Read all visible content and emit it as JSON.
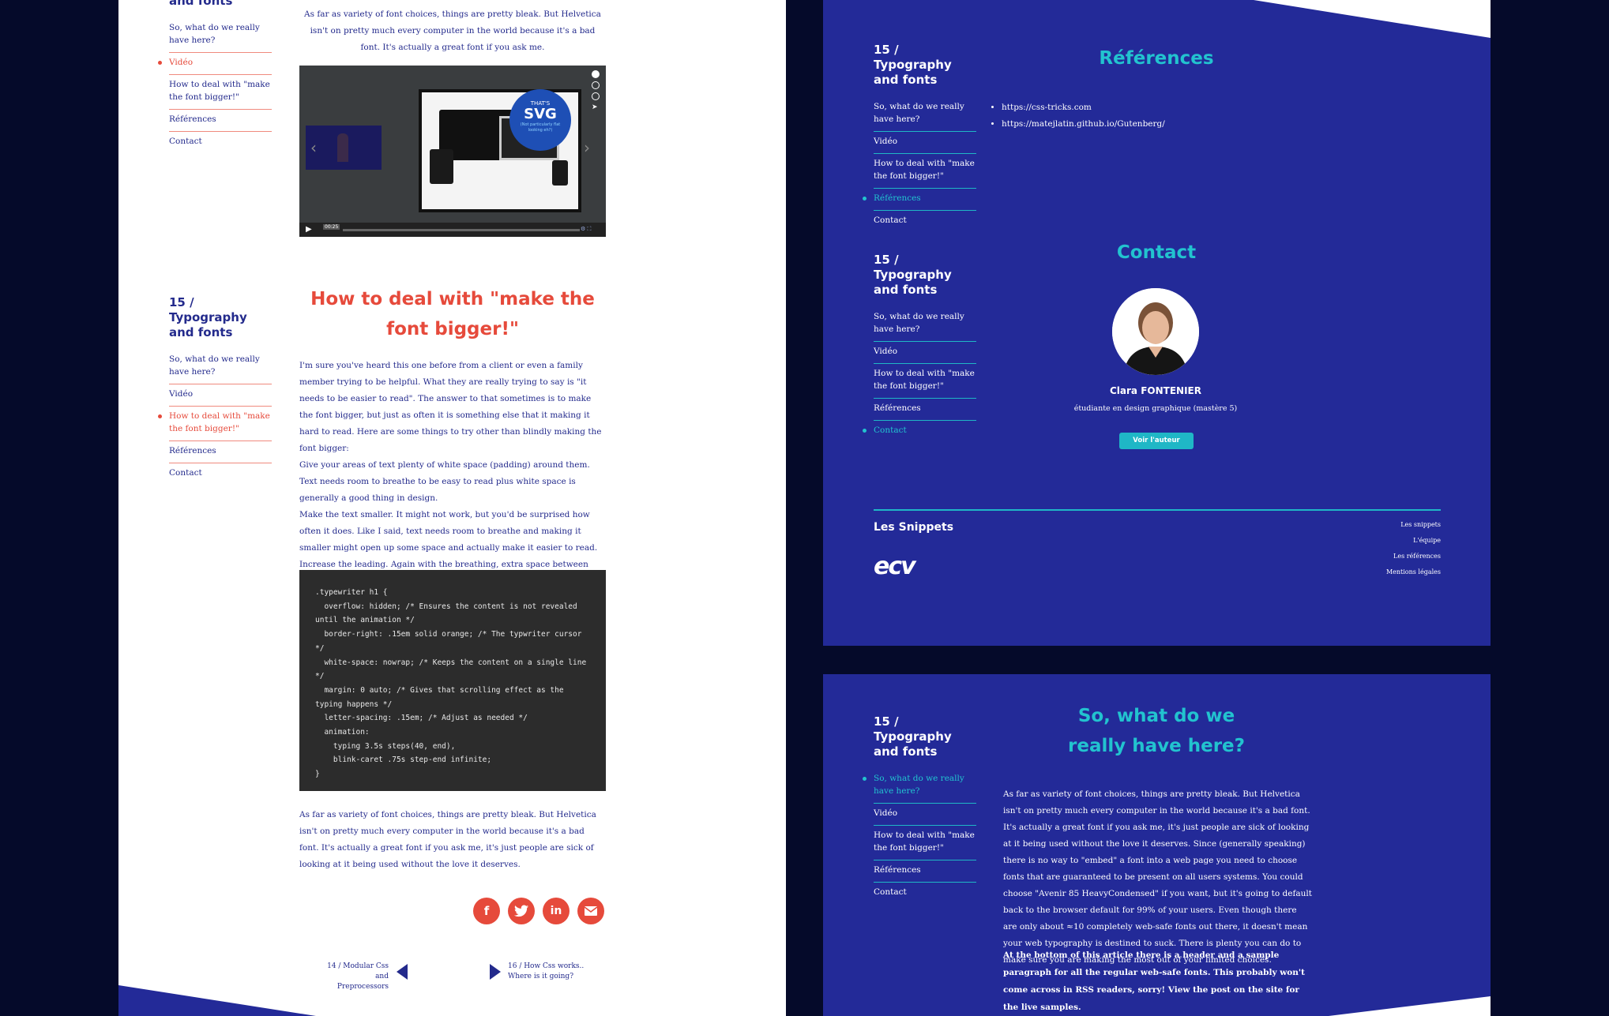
{
  "colors": {
    "navy": "#050a2a",
    "brand_blue": "#232a98",
    "text_blue": "#232a8c",
    "accent_red": "#e64a3b",
    "accent_cyan": "#22c3cf"
  },
  "left": {
    "nav_top": {
      "title": "and fonts",
      "items": [
        "So, what do we really have here?",
        "Vidéo",
        "How to deal with \"make the font bigger!\"",
        "Références",
        "Contact"
      ],
      "active_index": 1
    },
    "intro_para": "As far as variety of font choices, things are pretty bleak. But Helvetica isn't on pretty much every computer in the world because it's a bad font. It's actually a great font if you ask me.",
    "video": {
      "badge_line1": "THAT'S",
      "badge_line2": "SVG",
      "badge_line3": "(Not particularly flat looking eh?)",
      "time": "00:25"
    },
    "nav_mid": {
      "title": "15 / Typography and fonts",
      "items": [
        "So, what do we really have here?",
        "Vidéo",
        "How to deal with \"make the font bigger!\"",
        "Références",
        "Contact"
      ],
      "active_index": 2
    },
    "heading": "How to deal with \"make the font bigger!\"",
    "body_para": "I'm sure you've heard this one before from a client or even a family member trying to be helpful. What they are really trying to say is \"it needs to be easier to read\". The answer to that sometimes is to make the font bigger, but just as often it is something else that it making it hard to read. Here are some things to try other than blindly making the font bigger:\nGive your areas of text plenty of white space (padding) around them. Text needs room to breathe to be easy to read plus white space is generally a good thing in design.\nMake the text smaller. It might not work, but you'd be surprised how often it does. Like I said, text needs room to breathe and making it smaller might open up some space and actually make it easier to read.\nIncrease the leading. Again with the breathing, extra space between lines can be just what the doctor ordered.",
    "code": ".typewriter h1 {\n  overflow: hidden; /* Ensures the content is not revealed until the animation */\n  border-right: .15em solid orange; /* The typwriter cursor */\n  white-space: nowrap; /* Keeps the content on a single line */\n  margin: 0 auto; /* Gives that scrolling effect as the typing happens */\n  letter-spacing: .15em; /* Adjust as needed */\n  animation:\n    typing 3.5s steps(40, end),\n    blink-caret .75s step-end infinite;\n}",
    "outro_para": "As far as variety of font choices, things are pretty bleak. But Helvetica isn't on pretty much every computer in the world because it's a bad font. It's actually a great font if you ask me, it's just people are sick of looking at it being used without the love it deserves.",
    "share_icons": [
      "facebook-icon",
      "twitter-icon",
      "linkedin-icon",
      "mail-icon"
    ],
    "prev": {
      "line1": "14 / Modular Css",
      "line2": "and Preprocessors"
    },
    "next": {
      "line1": "16 / How Css works..",
      "line2": "Where is it going?"
    }
  },
  "right_top": {
    "nav_refs": {
      "title": "15 / Typography and fonts",
      "items": [
        "So, what do we really have here?",
        "Vidéo",
        "How to deal with \"make the font bigger!\"",
        "Références",
        "Contact"
      ],
      "active_index": 3
    },
    "refs_heading": "Références",
    "refs_links": [
      "https://css-tricks.com",
      "https://matejlatin.github.io/Gutenberg/"
    ],
    "nav_contact": {
      "title": "15 / Typography and fonts",
      "items": [
        "So, what do we really have here?",
        "Vidéo",
        "How to deal with \"make the font bigger!\"",
        "Références",
        "Contact"
      ],
      "active_index": 4
    },
    "contact_heading": "Contact",
    "author_name": "Clara FONTENIER",
    "author_role": "étudiante en design graphique (mastère 5)",
    "author_button": "Voir l'auteur",
    "footer": {
      "brand": "Les Snippets",
      "logo": "ecv",
      "links": [
        "Les snippets",
        "L'équipe",
        "Les références",
        "Mentions légales"
      ]
    }
  },
  "right_bottom": {
    "nav": {
      "title": "15 / Typography and fonts",
      "items": [
        "So, what do we really have here?",
        "Vidéo",
        "How to deal with \"make the font bigger!\"",
        "Références",
        "Contact"
      ],
      "active_index": 0
    },
    "heading": "So, what do we really have here?",
    "para": "As far as variety of font choices, things are pretty bleak. But Helvetica isn't on pretty much every computer in the world because it's a bad font. It's actually a great font if you ask me, it's just people are sick of looking at it being used without the love it deserves. Since (generally speaking) there is no way to \"embed\" a font into a web page you need to choose fonts that are guaranteed to be present on all users systems. You could choose \"Avenir 85 HeavyCondensed\" if you want, but it's going to default back to the browser default for 99% of your users. Even though there are only about ≈10 completely web-safe fonts out there, it doesn't mean your web typography is destined to suck. There is plenty you can do to make sure you are making the most out of your limited choices.",
    "bold_para": "At the bottom of this article there is a header and a sample paragraph for all the regular web-safe fonts. This probably won't come across in RSS readers, sorry! View the post on the site for the live samples."
  }
}
